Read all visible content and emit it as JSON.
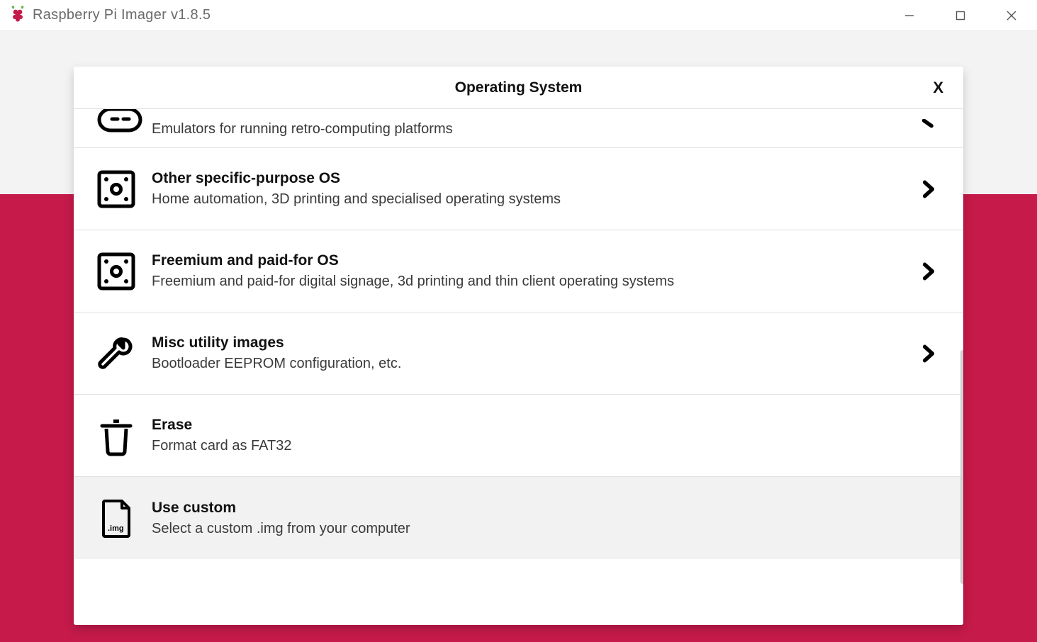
{
  "window": {
    "title": "Raspberry Pi Imager v1.8.5"
  },
  "modal": {
    "title": "Operating System",
    "close_label": "X"
  },
  "items": [
    {
      "title": "",
      "subtitle": "Emulators for running retro-computing platforms",
      "has_chevron": true,
      "icon": "robot"
    },
    {
      "title": "Other specific-purpose OS",
      "subtitle": "Home automation, 3D printing and specialised operating systems",
      "has_chevron": true,
      "icon": "die"
    },
    {
      "title": "Freemium and paid-for OS",
      "subtitle": "Freemium and paid-for digital signage, 3d printing and thin client operating systems",
      "has_chevron": true,
      "icon": "die"
    },
    {
      "title": "Misc utility images",
      "subtitle": "Bootloader EEPROM configuration, etc.",
      "has_chevron": true,
      "icon": "wrench"
    },
    {
      "title": "Erase",
      "subtitle": "Format card as FAT32",
      "has_chevron": false,
      "icon": "trash"
    },
    {
      "title": "Use custom",
      "subtitle": "Select a custom .img from your computer",
      "has_chevron": false,
      "icon": "img-file",
      "img_label": ".img"
    }
  ]
}
